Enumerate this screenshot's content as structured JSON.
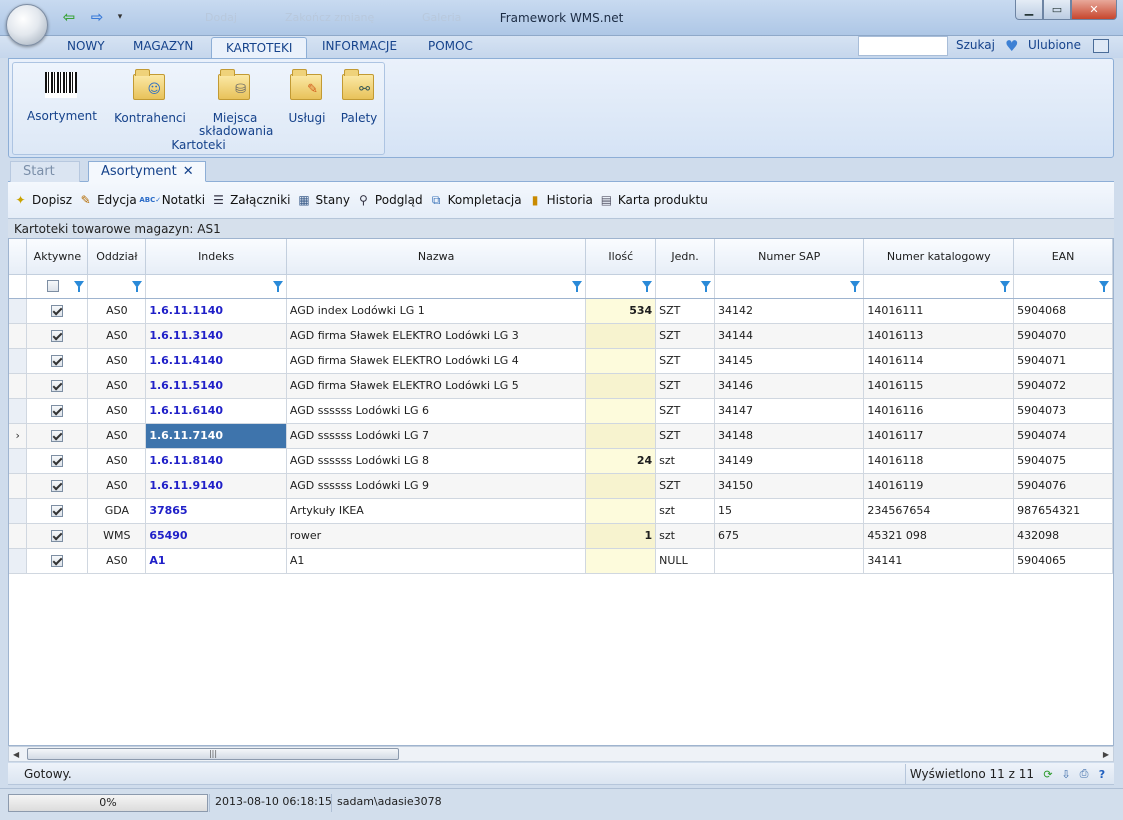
{
  "window": {
    "title": "Framework WMS.net",
    "ghost_items": [
      "Dodaj",
      "Zakończ zmianę",
      "Galeria"
    ]
  },
  "ribbon": {
    "tabs": [
      "NOWY",
      "MAGAZYN",
      "KARTOTEKI",
      "INFORMACJE",
      "POMOC"
    ],
    "active_tab": "KARTOTEKI",
    "search_label": "Szukaj",
    "search_value": "",
    "favorites_label": "Ulubione",
    "group_label": "Kartoteki",
    "buttons": [
      {
        "label": "Asortyment",
        "icon": "barcode-icon"
      },
      {
        "label": "Kontrahenci",
        "icon": "folder-people-icon"
      },
      {
        "label": "Miejsca składowania",
        "icon": "folder-database-icon"
      },
      {
        "label": "Usługi",
        "icon": "folder-pencil-icon"
      },
      {
        "label": "Palety",
        "icon": "folder-binoculars-icon"
      }
    ]
  },
  "doc_tabs": {
    "start": "Start",
    "active": "Asortyment"
  },
  "toolbar": {
    "items": [
      {
        "label": "Dopisz",
        "icon": "new-doc-icon"
      },
      {
        "label": "Edycja",
        "icon": "edit-icon"
      },
      {
        "label": "Notatki",
        "icon": "spellcheck-icon"
      },
      {
        "label": "Załączniki",
        "icon": "list-icon"
      },
      {
        "label": "Stany",
        "icon": "table-icon"
      },
      {
        "label": "Podgląd",
        "icon": "magnifier-icon"
      },
      {
        "label": "Kompletacja",
        "icon": "copy-docs-icon"
      },
      {
        "label": "Historia",
        "icon": "chart-icon"
      },
      {
        "label": "Karta produktu",
        "icon": "document-icon"
      }
    ]
  },
  "grid": {
    "caption": "Kartoteki towarowe magazyn: AS1",
    "columns": [
      "Aktywne",
      "Oddział",
      "Indeks",
      "Nazwa",
      "Ilość",
      "Jedn.",
      "Numer SAP",
      "Numer katalogowy",
      "EAN"
    ],
    "rows": [
      {
        "active": true,
        "branch": "AS0",
        "index": "1.6.11.1140",
        "name": "AGD index Lodówki LG 1",
        "qty": "534",
        "unit": "SZT",
        "sap": "34142",
        "catalog": "14016111",
        "ean": "5904068"
      },
      {
        "active": true,
        "branch": "AS0",
        "index": "1.6.11.3140",
        "name": "AGD firma Sławek ELEKTRO Lodówki LG 3",
        "qty": "",
        "unit": "SZT",
        "sap": "34144",
        "catalog": "14016113",
        "ean": "5904070"
      },
      {
        "active": true,
        "branch": "AS0",
        "index": "1.6.11.4140",
        "name": "AGD firma Sławek ELEKTRO Lodówki LG 4",
        "qty": "",
        "unit": "SZT",
        "sap": "34145",
        "catalog": "14016114",
        "ean": "5904071"
      },
      {
        "active": true,
        "branch": "AS0",
        "index": "1.6.11.5140",
        "name": "AGD firma Sławek ELEKTRO Lodówki LG 5",
        "qty": "",
        "unit": "SZT",
        "sap": "34146",
        "catalog": "14016115",
        "ean": "5904072"
      },
      {
        "active": true,
        "branch": "AS0",
        "index": "1.6.11.6140",
        "name": "AGD ssssss Lodówki LG 6",
        "qty": "",
        "unit": "SZT",
        "sap": "34147",
        "catalog": "14016116",
        "ean": "5904073"
      },
      {
        "active": true,
        "branch": "AS0",
        "index": "1.6.11.7140",
        "name": "AGD ssssss Lodówki LG 7",
        "qty": "",
        "unit": "SZT",
        "sap": "34148",
        "catalog": "14016117",
        "ean": "5904074",
        "selected": true
      },
      {
        "active": true,
        "branch": "AS0",
        "index": "1.6.11.8140",
        "name": "AGD ssssss Lodówki LG 8",
        "qty": "24",
        "unit": "szt",
        "sap": "34149",
        "catalog": "14016118",
        "ean": "5904075"
      },
      {
        "active": true,
        "branch": "AS0",
        "index": "1.6.11.9140",
        "name": "AGD ssssss Lodówki LG 9",
        "qty": "",
        "unit": "SZT",
        "sap": "34150",
        "catalog": "14016119",
        "ean": "5904076"
      },
      {
        "active": true,
        "branch": "GDA",
        "index": "37865",
        "name": "Artykuły IKEA",
        "qty": "",
        "unit": "szt",
        "sap": "15",
        "catalog": "234567654",
        "ean": "987654321"
      },
      {
        "active": true,
        "branch": "WMS",
        "index": "65490",
        "name": "rower",
        "qty": "1",
        "unit": "szt",
        "sap": "675",
        "catalog": "45321 098",
        "ean": "432098"
      },
      {
        "active": true,
        "branch": "AS0",
        "index": "A1",
        "name": "A1",
        "qty": "",
        "unit": "NULL",
        "sap": "",
        "catalog": "34141",
        "ean": "5904065"
      }
    ],
    "current_row_marker": "›"
  },
  "status": {
    "text": "Gotowy.",
    "count": "Wyświetlono 11 z 11"
  },
  "bottom": {
    "progress": "0%",
    "datetime": "2013-08-10 06:18:15",
    "user": "sadam\\adasie3078"
  }
}
